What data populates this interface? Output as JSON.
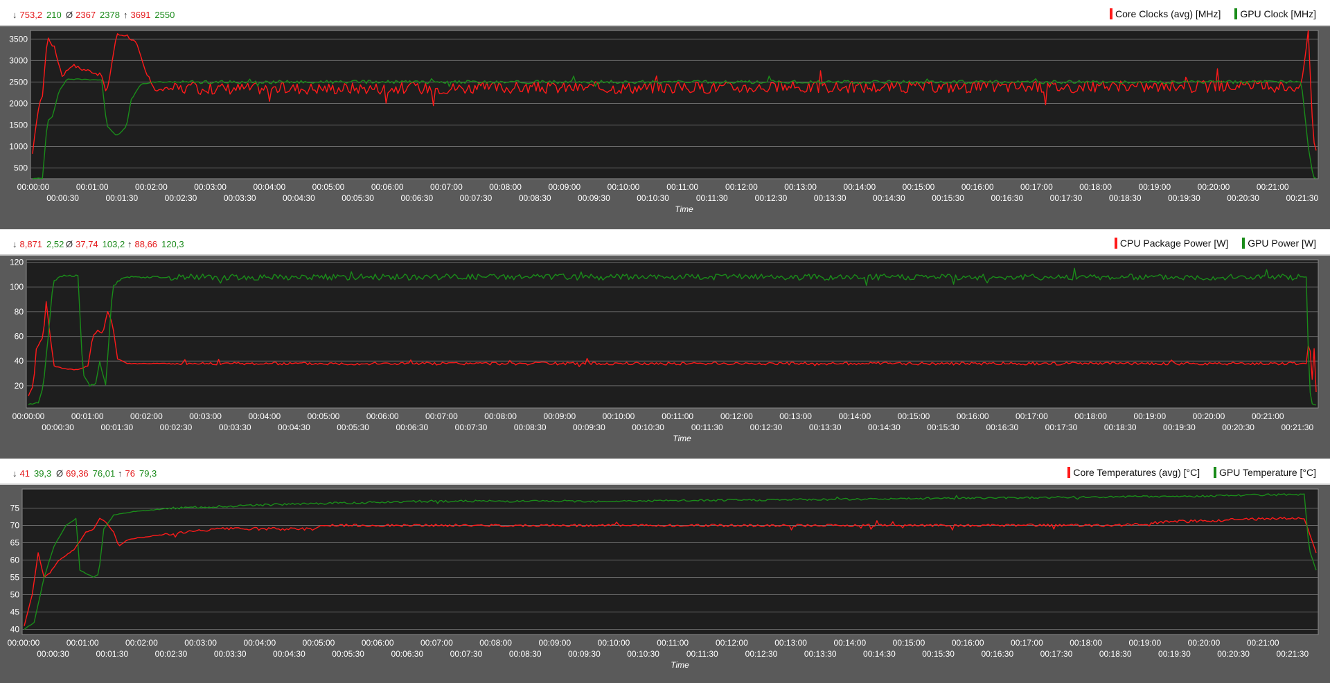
{
  "colors": {
    "red": "#ff1a1a",
    "green": "#1a8c1a",
    "plot_bg": "#1e1e1e",
    "panel_bg": "#5a5a5a",
    "grid": "#6a6a6a"
  },
  "x_ticks_upper": [
    "00:00:00",
    "00:01:00",
    "00:02:00",
    "00:03:00",
    "00:04:00",
    "00:05:00",
    "00:06:00",
    "00:07:00",
    "00:08:00",
    "00:09:00",
    "00:10:00",
    "00:11:00",
    "00:12:00",
    "00:13:00",
    "00:14:00",
    "00:15:00",
    "00:16:00",
    "00:17:00",
    "00:18:00",
    "00:19:00",
    "00:20:00",
    "00:21:00"
  ],
  "x_ticks_lower": [
    "00:00:30",
    "00:01:30",
    "00:02:30",
    "00:03:30",
    "00:04:30",
    "00:05:30",
    "00:06:30",
    "00:07:30",
    "00:08:30",
    "00:09:30",
    "00:10:30",
    "00:11:30",
    "00:12:30",
    "00:13:30",
    "00:14:30",
    "00:15:30",
    "00:16:30",
    "00:17:30",
    "00:18:30",
    "00:19:30",
    "00:20:30",
    "00:21:30"
  ],
  "xlabel": "Time",
  "panels": [
    {
      "stats": {
        "min_red": "753,2",
        "min_green": "210",
        "avg_red": "2367",
        "avg_green": "2378",
        "max_red": "3691",
        "max_green": "2550"
      },
      "legend": [
        "Core Clocks (avg) [MHz]",
        "GPU Clock [MHz]"
      ]
    },
    {
      "stats": {
        "min_red": "8,871",
        "min_green": "2,52",
        "avg_red": "37,74",
        "avg_green": "103,2",
        "max_red": "88,66",
        "max_green": "120,3"
      },
      "legend": [
        "CPU Package Power [W]",
        "GPU Power [W]"
      ]
    },
    {
      "stats": {
        "min_red": "41",
        "min_green": "39,3",
        "avg_red": "69,36",
        "avg_green": "76,01",
        "max_red": "76",
        "max_green": "79,3"
      },
      "legend": [
        "Core Temperatures (avg) [°C]",
        "GPU Temperature [°C]"
      ]
    }
  ],
  "chart_data": [
    {
      "type": "line",
      "title": "",
      "xlabel": "Time",
      "ylabel": "",
      "x_unit": "seconds",
      "x_range": [
        0,
        1300
      ],
      "ylim": [
        250,
        3700
      ],
      "yticks": [
        500,
        1000,
        1500,
        2000,
        2500,
        3000,
        3500
      ],
      "series": [
        {
          "name": "Core Clocks (avg) [MHz]",
          "color": "#ff1a1a",
          "base": 2360,
          "noise": 140,
          "points": [
            [
              0,
              800
            ],
            [
              5,
              1800
            ],
            [
              10,
              2200
            ],
            [
              15,
              3550
            ],
            [
              22,
              3300
            ],
            [
              30,
              2650
            ],
            [
              40,
              2900
            ],
            [
              50,
              2800
            ],
            [
              60,
              2750
            ],
            [
              70,
              2650
            ],
            [
              75,
              2200
            ],
            [
              85,
              3600
            ],
            [
              95,
              3600
            ],
            [
              105,
              3400
            ],
            [
              115,
              2700
            ],
            [
              125,
              2300
            ],
            [
              140,
              2350
            ],
            [
              1285,
              2400
            ],
            [
              1292,
              3700
            ],
            [
              1297,
              1200
            ],
            [
              1300,
              900
            ]
          ]
        },
        {
          "name": "GPU Clock [MHz]",
          "color": "#1a8c1a",
          "base": 2460,
          "noise": 40,
          "points": [
            [
              0,
              250
            ],
            [
              10,
              260
            ],
            [
              15,
              1600
            ],
            [
              20,
              1700
            ],
            [
              27,
              2300
            ],
            [
              35,
              2570
            ],
            [
              70,
              2550
            ],
            [
              75,
              1500
            ],
            [
              85,
              1250
            ],
            [
              95,
              1450
            ],
            [
              100,
              2100
            ],
            [
              110,
              2450
            ],
            [
              125,
              2500
            ],
            [
              1285,
              2500
            ],
            [
              1292,
              1000
            ],
            [
              1297,
              300
            ],
            [
              1300,
              250
            ]
          ]
        }
      ]
    },
    {
      "type": "line",
      "title": "",
      "xlabel": "Time",
      "ylabel": "",
      "x_unit": "seconds",
      "x_range": [
        0,
        1300
      ],
      "ylim": [
        2,
        122
      ],
      "yticks": [
        20,
        40,
        60,
        80,
        100,
        120
      ],
      "series": [
        {
          "name": "CPU Package Power [W]",
          "color": "#ff1a1a",
          "base": 37.8,
          "noise": 1.2,
          "points": [
            [
              0,
              12
            ],
            [
              5,
              20
            ],
            [
              8,
              50
            ],
            [
              15,
              60
            ],
            [
              18,
              88
            ],
            [
              22,
              60
            ],
            [
              26,
              36
            ],
            [
              35,
              34
            ],
            [
              50,
              33
            ],
            [
              60,
              36
            ],
            [
              65,
              60
            ],
            [
              70,
              65
            ],
            [
              75,
              62
            ],
            [
              80,
              80
            ],
            [
              85,
              70
            ],
            [
              90,
              42
            ],
            [
              100,
              38
            ],
            [
              1290,
              38
            ],
            [
              1293,
              60
            ],
            [
              1296,
              25
            ],
            [
              1298,
              50
            ],
            [
              1300,
              15
            ]
          ]
        },
        {
          "name": "GPU Power [W]",
          "color": "#1a8c1a",
          "base": 108,
          "noise": 2.5,
          "points": [
            [
              0,
              5
            ],
            [
              10,
              6
            ],
            [
              15,
              20
            ],
            [
              20,
              60
            ],
            [
              25,
              105
            ],
            [
              35,
              109
            ],
            [
              50,
              109
            ],
            [
              55,
              30
            ],
            [
              62,
              20
            ],
            [
              68,
              22
            ],
            [
              72,
              40
            ],
            [
              78,
              20
            ],
            [
              85,
              100
            ],
            [
              95,
              108
            ],
            [
              1290,
              108
            ],
            [
              1293,
              20
            ],
            [
              1296,
              5
            ],
            [
              1300,
              4
            ]
          ]
        }
      ]
    },
    {
      "type": "line",
      "title": "",
      "xlabel": "Time",
      "ylabel": "",
      "x_unit": "seconds",
      "x_range": [
        0,
        1300
      ],
      "ylim": [
        38.5,
        80.5
      ],
      "yticks": [
        40,
        45,
        50,
        55,
        60,
        65,
        70,
        75
      ],
      "series": [
        {
          "name": "Core Temperatures (avg) [°C]",
          "color": "#ff1a1a",
          "base": 70,
          "noise": 0.4,
          "points": [
            [
              0,
              41
            ],
            [
              8,
              50
            ],
            [
              14,
              62
            ],
            [
              20,
              55
            ],
            [
              25,
              56
            ],
            [
              35,
              60
            ],
            [
              50,
              63
            ],
            [
              62,
              68
            ],
            [
              70,
              69
            ],
            [
              76,
              72
            ],
            [
              82,
              71
            ],
            [
              90,
              68
            ],
            [
              95,
              64
            ],
            [
              105,
              66
            ],
            [
              130,
              67
            ],
            [
              160,
              68
            ],
            [
              200,
              69
            ],
            [
              290,
              69
            ],
            [
              300,
              70
            ],
            [
              700,
              70
            ],
            [
              900,
              70
            ],
            [
              1000,
              70
            ],
            [
              1100,
              70
            ],
            [
              1150,
              71
            ],
            [
              1260,
              72
            ],
            [
              1288,
              72
            ],
            [
              1293,
              68
            ],
            [
              1300,
              62
            ]
          ]
        },
        {
          "name": "GPU Temperature [°C]",
          "color": "#1a8c1a",
          "base": 77,
          "noise": 0.3,
          "points": [
            [
              0,
              40
            ],
            [
              10,
              42
            ],
            [
              20,
              55
            ],
            [
              30,
              64
            ],
            [
              42,
              70
            ],
            [
              52,
              72
            ],
            [
              56,
              57
            ],
            [
              63,
              56
            ],
            [
              70,
              55
            ],
            [
              75,
              56
            ],
            [
              80,
              69
            ],
            [
              90,
              73
            ],
            [
              110,
              74
            ],
            [
              150,
              75
            ],
            [
              250,
              76
            ],
            [
              400,
              77
            ],
            [
              600,
              77
            ],
            [
              800,
              77.5
            ],
            [
              1000,
              78
            ],
            [
              1200,
              78.5
            ],
            [
              1288,
              79
            ],
            [
              1293,
              63
            ],
            [
              1300,
              57
            ]
          ]
        }
      ]
    }
  ]
}
